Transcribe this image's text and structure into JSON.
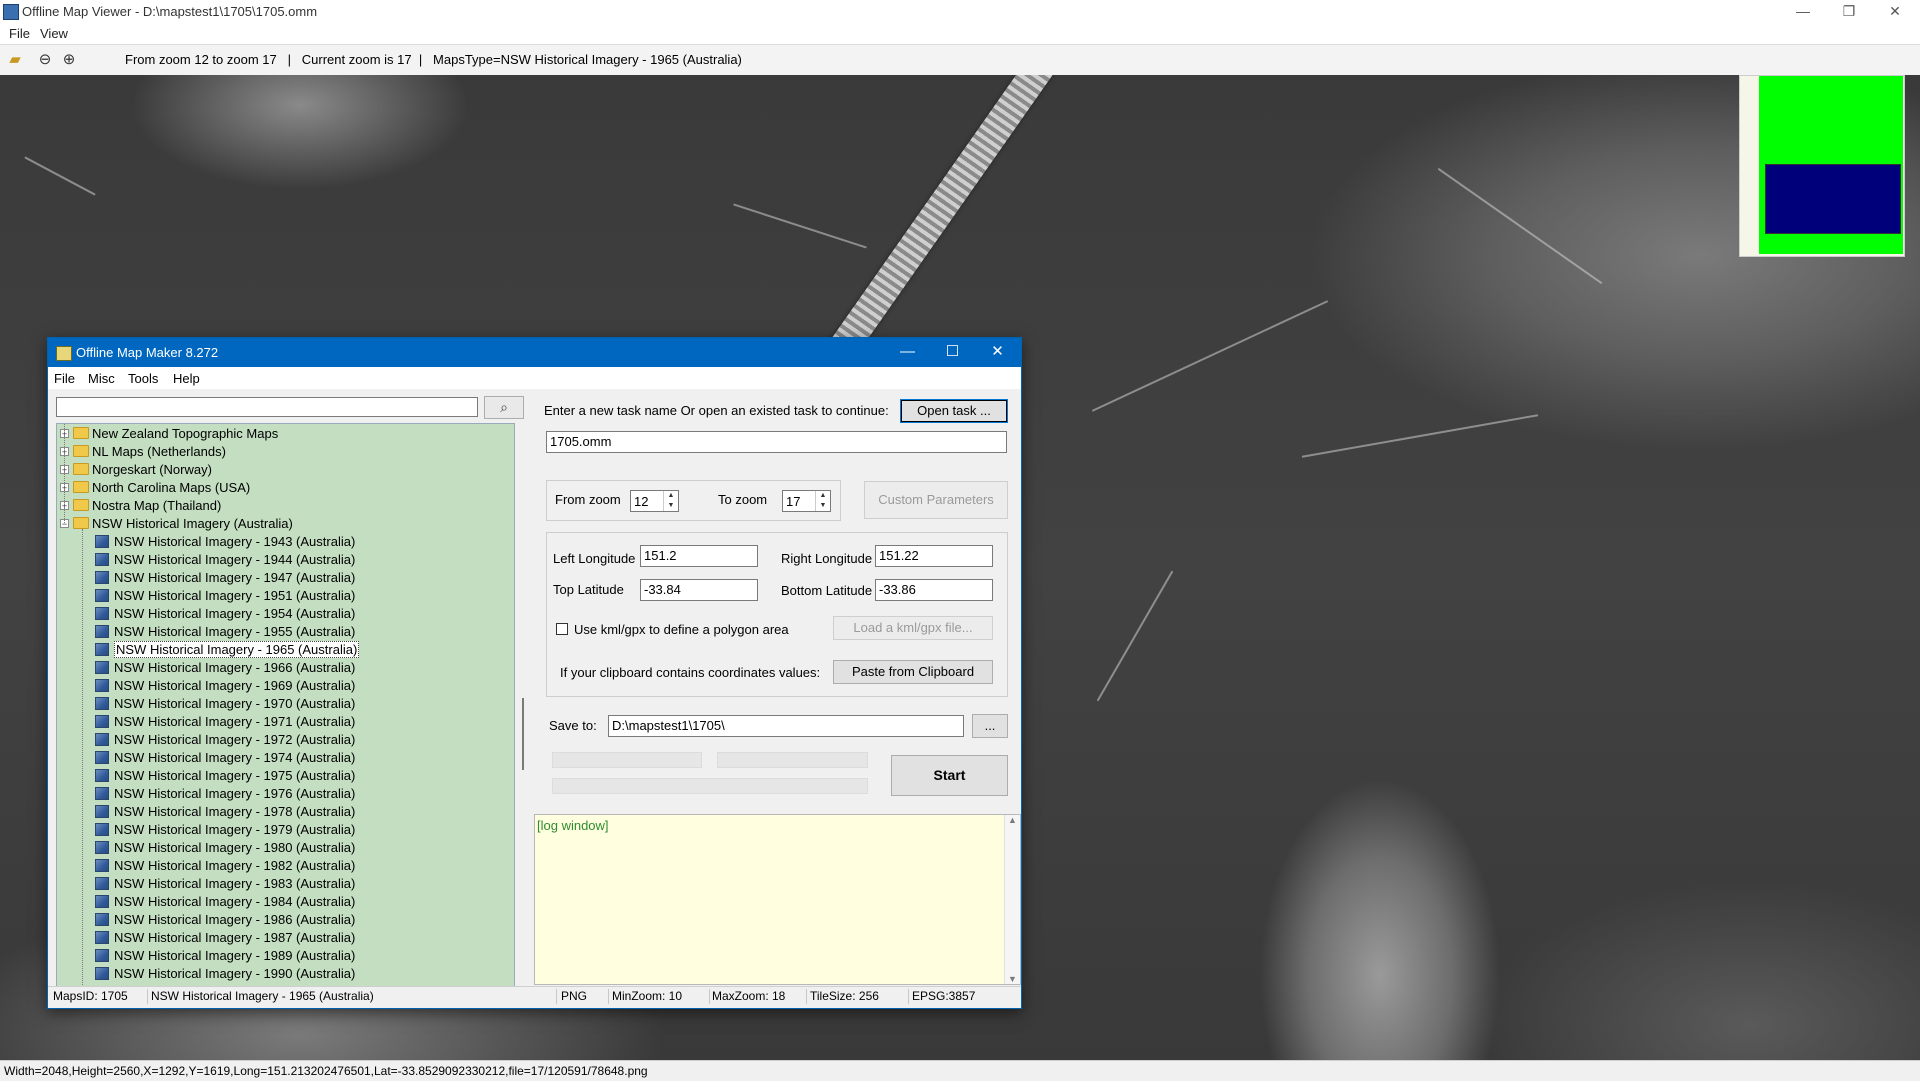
{
  "window": {
    "title": "Offline Map Viewer - D:\\mapstest1\\1705\\1705.omm",
    "controls": {
      "minimize": "—",
      "restore": "❐",
      "close": "✕"
    }
  },
  "menu": {
    "file": "File",
    "view": "View"
  },
  "toolbar": {
    "zoom_info": "From zoom 12 to zoom 17   |   Current zoom is 17  |   MapsType=NSW Historical Imagery - 1965 (Australia)"
  },
  "statusbar": {
    "text": "Width=2048,Height=2560,X=1292,Y=1619,Long=151.213202476501,Lat=-33.8529092330212,file=17/120591/78648.png"
  },
  "dialog": {
    "title": "Offline Map Maker 8.272",
    "controls": {
      "minimize": "—",
      "maximize": "☐",
      "close": "✕"
    },
    "menu": {
      "file": "File",
      "misc": "Misc",
      "tools": "Tools",
      "help": "Help"
    },
    "search": {
      "value": "",
      "button_icon": "search-icon"
    },
    "tree": {
      "folders": [
        {
          "label": "New Zealand Topographic Maps",
          "expanded": false
        },
        {
          "label": "NL Maps (Netherlands)",
          "expanded": false
        },
        {
          "label": "Norgeskart (Norway)",
          "expanded": false
        },
        {
          "label": "North Carolina Maps (USA)",
          "expanded": false
        },
        {
          "label": "Nostra Map (Thailand)",
          "expanded": false
        },
        {
          "label": "NSW Historical Imagery (Australia)",
          "expanded": true
        }
      ],
      "children": [
        "NSW Historical Imagery - 1943 (Australia)",
        "NSW Historical Imagery - 1944 (Australia)",
        "NSW Historical Imagery - 1947 (Australia)",
        "NSW Historical Imagery - 1951 (Australia)",
        "NSW Historical Imagery - 1954 (Australia)",
        "NSW Historical Imagery - 1955 (Australia)",
        "NSW Historical Imagery - 1965 (Australia)",
        "NSW Historical Imagery - 1966 (Australia)",
        "NSW Historical Imagery - 1969 (Australia)",
        "NSW Historical Imagery - 1970 (Australia)",
        "NSW Historical Imagery - 1971 (Australia)",
        "NSW Historical Imagery - 1972 (Australia)",
        "NSW Historical Imagery - 1974 (Australia)",
        "NSW Historical Imagery - 1975 (Australia)",
        "NSW Historical Imagery - 1976 (Australia)",
        "NSW Historical Imagery - 1978 (Australia)",
        "NSW Historical Imagery - 1979 (Australia)",
        "NSW Historical Imagery - 1980 (Australia)",
        "NSW Historical Imagery - 1982 (Australia)",
        "NSW Historical Imagery - 1983 (Australia)",
        "NSW Historical Imagery - 1984 (Australia)",
        "NSW Historical Imagery - 1986 (Australia)",
        "NSW Historical Imagery - 1987 (Australia)",
        "NSW Historical Imagery - 1989 (Australia)",
        "NSW Historical Imagery - 1990 (Australia)"
      ],
      "selected": "NSW Historical Imagery - 1965 (Australia)"
    },
    "task": {
      "prompt": "Enter a new task name Or open an existed task to continue:",
      "open_button": "Open task ...",
      "name_value": "1705.omm"
    },
    "zoom": {
      "from_label": "From zoom",
      "from_value": "12",
      "to_label": "To zoom",
      "to_value": "17",
      "custom_button": "Custom Parameters"
    },
    "coords": {
      "left_lon_label": "Left Longitude",
      "left_lon_value": "151.2",
      "right_lon_label": "Right Longitude",
      "right_lon_value": "151.22",
      "top_lat_label": "Top Latitude",
      "top_lat_value": "-33.84",
      "bottom_lat_label": "Bottom Latitude",
      "bottom_lat_value": "-33.86",
      "kml_checkbox_label": "Use kml/gpx to define a polygon area",
      "kml_button": "Load a kml/gpx file...",
      "clipboard_label": "If your clipboard contains coordinates values:",
      "clipboard_button": "Paste from Clipboard"
    },
    "save": {
      "label": "Save to:",
      "value": "D:\\mapstest1\\1705\\",
      "browse_button": "...",
      "start_button": "Start"
    },
    "log": {
      "text": "[log window]"
    },
    "status": {
      "maps_id": "MapsID: 1705",
      "maps_name": "NSW Historical Imagery - 1965 (Australia)",
      "format": "PNG",
      "min_zoom": "MinZoom: 10",
      "max_zoom": "MaxZoom: 18",
      "tile_size": "TileSize: 256",
      "epsg": "EPSG:3857"
    }
  }
}
